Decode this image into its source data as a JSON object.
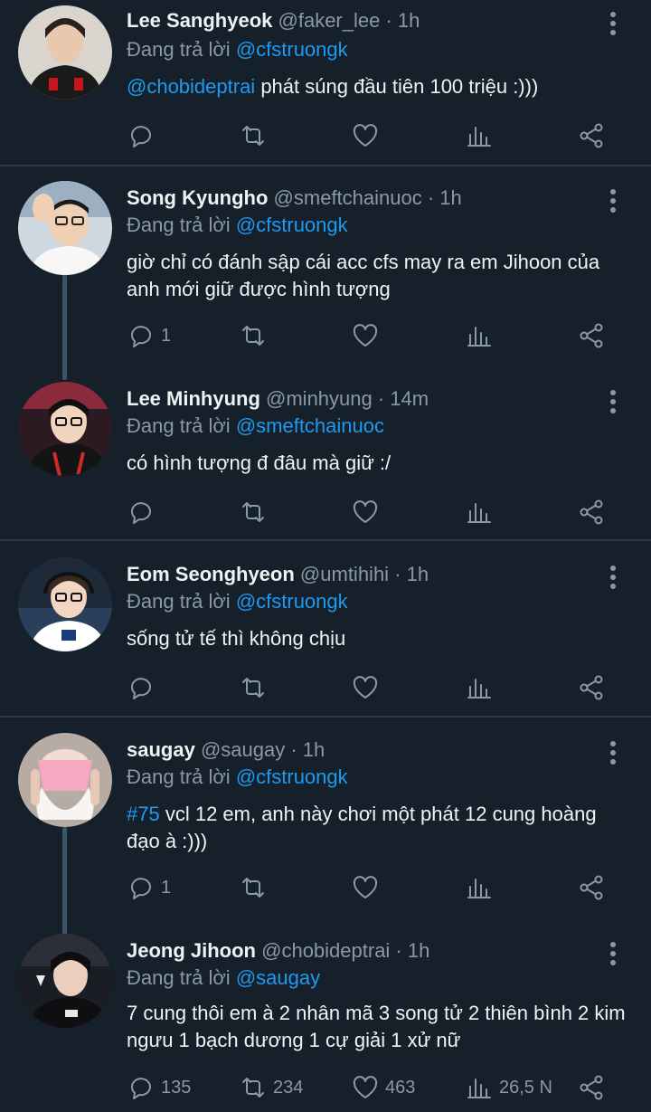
{
  "colors": {
    "background": "#15202b",
    "link": "#1d9bf0",
    "muted": "#8b98a5",
    "divider": "#2f3a44"
  },
  "tweets": [
    {
      "name": "Lee Sanghyeok",
      "handle": "@faker_lee",
      "time": "· 1h",
      "reply_prefix": "Đang trả lời ",
      "reply_to": "@cfstruongk",
      "mention": "@chobideptrai",
      "text": " phát súng đầu tiên 100 triệu :)))",
      "replies": "",
      "retweets": "",
      "likes": "",
      "views": ""
    },
    {
      "name": "Song Kyungho",
      "handle": "@smeftchainuoc",
      "time": "· 1h",
      "reply_prefix": "Đang trả lời ",
      "reply_to": "@cfstruongk",
      "text": "giờ chỉ có đánh sập cái acc cfs may ra em Jihoon của anh mới giữ được hình tượng",
      "replies": "1",
      "retweets": "",
      "likes": "",
      "views": ""
    },
    {
      "name": "Lee Minhyung",
      "handle": "@minhyung",
      "time": "· 14m",
      "reply_prefix": "Đang trả lời ",
      "reply_to": "@smeftchainuoc",
      "text": "có hình tượng đ đâu mà giữ :/",
      "replies": "",
      "retweets": "",
      "likes": "",
      "views": ""
    },
    {
      "name": "Eom Seonghyeon",
      "handle": "@umtihihi",
      "time": "· 1h",
      "reply_prefix": "Đang trả lời ",
      "reply_to": "@cfstruongk",
      "text": "sống tử tế thì không chịu",
      "replies": "",
      "retweets": "",
      "likes": "",
      "views": ""
    },
    {
      "name": "saugay",
      "handle": "@saugay",
      "time": "· 1h",
      "reply_prefix": "Đang trả lời ",
      "reply_to": "@cfstruongk",
      "hashtag": "#75",
      "text": " vcl 12 em, anh này chơi một phát 12 cung hoàng đạo à :)))",
      "replies": "1",
      "retweets": "",
      "likes": "",
      "views": ""
    },
    {
      "name": "Jeong Jihoon",
      "handle": "@chobideptrai",
      "time": "· 1h",
      "reply_prefix": "Đang trả lời ",
      "reply_to": "@saugay",
      "text": "7 cung thôi em à 2 nhân mã 3 song tử 2 thiên bình 2 kim ngưu 1 bạch dương 1 cự giải 1 xử nữ",
      "replies": "135",
      "retweets": "234",
      "likes": "463",
      "views": "26,5 N"
    }
  ],
  "icons": [
    "reply-icon",
    "retweet-icon",
    "like-icon",
    "views-icon",
    "share-icon",
    "more-icon"
  ]
}
